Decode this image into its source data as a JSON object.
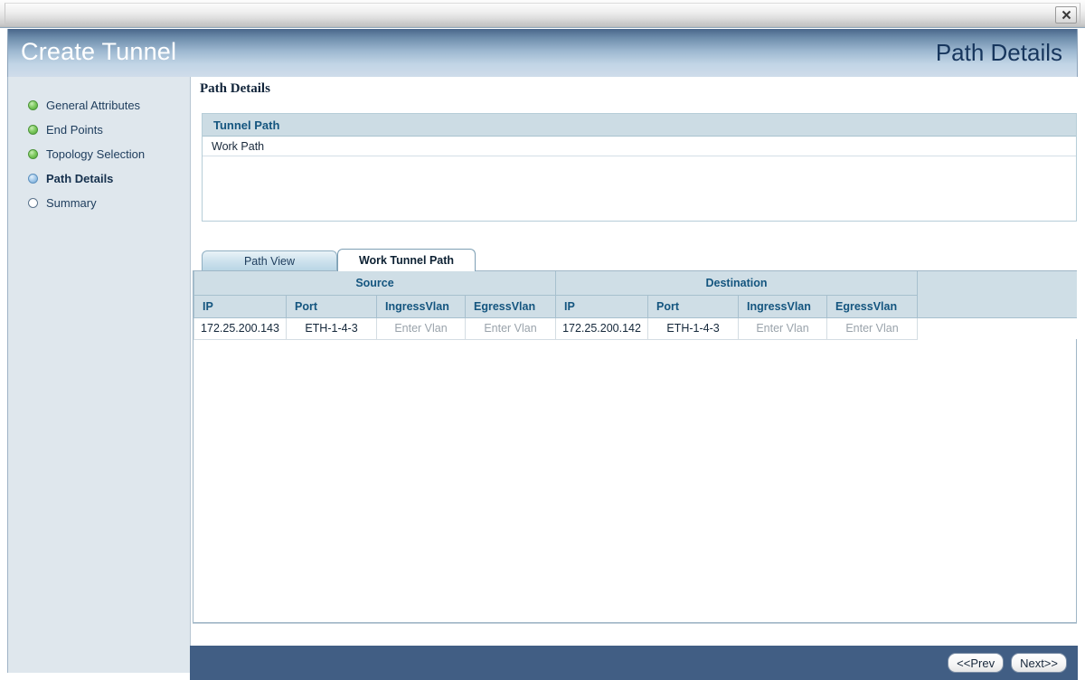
{
  "window": {
    "close_icon": "close-icon"
  },
  "header": {
    "wizard_title": "Create Tunnel",
    "step_title": "Path Details"
  },
  "sidebar": {
    "items": [
      {
        "label": "General Attributes",
        "state": "done"
      },
      {
        "label": "End Points",
        "state": "done"
      },
      {
        "label": "Topology Selection",
        "state": "done"
      },
      {
        "label": "Path Details",
        "state": "current"
      },
      {
        "label": "Summary",
        "state": "todo"
      }
    ]
  },
  "content": {
    "heading": "Path Details",
    "tunnel_path_panel": {
      "header": "Tunnel Path",
      "rows": [
        {
          "name": "Work Path"
        }
      ]
    },
    "tabs": [
      {
        "label": "Path View",
        "active": false
      },
      {
        "label": "Work Tunnel Path",
        "active": true
      }
    ],
    "table": {
      "group_headers": [
        {
          "label": "Source",
          "span": 4
        },
        {
          "label": "Destination",
          "span": 4
        },
        {
          "label": "",
          "span": 1
        }
      ],
      "columns": [
        "IP",
        "Port",
        "IngressVlan",
        "EgressVlan",
        "IP",
        "Port",
        "IngressVlan",
        "EgressVlan",
        ""
      ],
      "rows": [
        {
          "source_ip": "172.25.200.143",
          "source_port": "ETH-1-4-3",
          "source_ingress_vlan": "Enter Vlan",
          "source_egress_vlan": "Enter Vlan",
          "dest_ip": "172.25.200.142",
          "dest_port": "ETH-1-4-3",
          "dest_ingress_vlan": "Enter Vlan",
          "dest_egress_vlan": "Enter Vlan"
        }
      ]
    }
  },
  "footer": {
    "prev_label": "<<Prev",
    "next_label": "Next>>"
  },
  "colors": {
    "title_band_top": "#49668a",
    "title_band_bottom": "#cfdcea",
    "accent_header_text": "#14557f",
    "table_header_bg": "#cfdee6",
    "sidebar_bg": "#dfe7ed",
    "footer_bg": "#415e84",
    "step_done": "#4ea436",
    "step_current": "#6fa5d2"
  }
}
